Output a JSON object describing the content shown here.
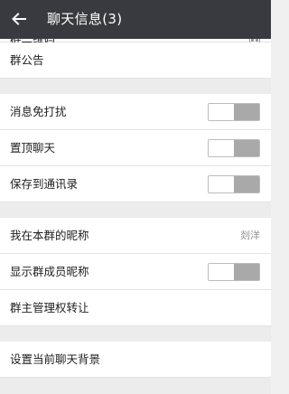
{
  "header": {
    "back_icon": "arrow-left-icon",
    "title": "聊天信息(3)"
  },
  "colors": {
    "header_bg": "#393a3f",
    "page_bg": "#ececec",
    "toggle_knob": "#a9a9a9"
  },
  "rows": {
    "qr_code": {
      "label": "群二维码",
      "icon": "qr-code-icon"
    },
    "announcement": {
      "label": "群公告"
    },
    "mute": {
      "label": "消息免打扰",
      "on": false
    },
    "sticky": {
      "label": "置顶聊天",
      "on": false
    },
    "save_contacts": {
      "label": "保存到通讯录",
      "on": false
    },
    "my_nickname": {
      "label": "我在本群的昵称",
      "value": "剡洋"
    },
    "show_nicknames": {
      "label": "显示群成员昵称",
      "on": false
    },
    "transfer_owner": {
      "label": "群主管理权转让"
    },
    "background": {
      "label": "设置当前聊天背景"
    }
  }
}
